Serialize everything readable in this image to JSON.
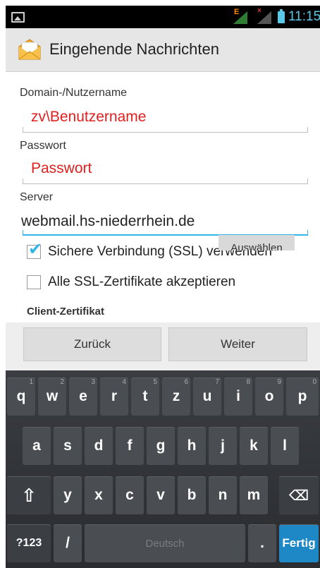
{
  "statusbar": {
    "time": "11:15",
    "icons": [
      "image-notification-icon",
      "signal-e-icon",
      "signal-no-sim-icon",
      "battery-icon"
    ]
  },
  "actionbar": {
    "title": "Eingehende Nachrichten",
    "icon": "email-app-icon"
  },
  "form": {
    "username": {
      "label": "Domain-/Nutzername",
      "value": "zv\\Benutzername"
    },
    "password": {
      "label": "Passwort",
      "value": "Passwort"
    },
    "server": {
      "label": "Server",
      "value": "webmail.hs-niederrhein.de"
    },
    "ssl": {
      "label": "Sichere Verbindung (SSL) verwenden",
      "checked": true
    },
    "accept_all": {
      "label": "Alle SSL-Zertifikate akzeptieren",
      "checked": false
    },
    "client_cert": {
      "label": "Client-Zertifikat",
      "button": "Auswählen"
    },
    "colors": {
      "value_red": "#e02020",
      "accent": "#33b5e5"
    }
  },
  "nav": {
    "back": "Zurück",
    "next": "Weiter"
  },
  "keyboard": {
    "row1": [
      {
        "k": "q",
        "h": "1"
      },
      {
        "k": "w",
        "h": "2"
      },
      {
        "k": "e",
        "h": "3"
      },
      {
        "k": "r",
        "h": "4"
      },
      {
        "k": "t",
        "h": "5"
      },
      {
        "k": "z",
        "h": "6"
      },
      {
        "k": "u",
        "h": "7"
      },
      {
        "k": "i",
        "h": "8"
      },
      {
        "k": "o",
        "h": "9"
      },
      {
        "k": "p",
        "h": "0"
      }
    ],
    "row2": [
      "a",
      "s",
      "d",
      "f",
      "g",
      "h",
      "j",
      "k",
      "l"
    ],
    "row3": [
      "y",
      "x",
      "c",
      "v",
      "b",
      "n",
      "m"
    ],
    "shift": "⇧",
    "backspace": "⌫",
    "symbols": "?123",
    "slash": "/",
    "space": "Deutsch",
    "period": ".",
    "done": "Fertig"
  }
}
